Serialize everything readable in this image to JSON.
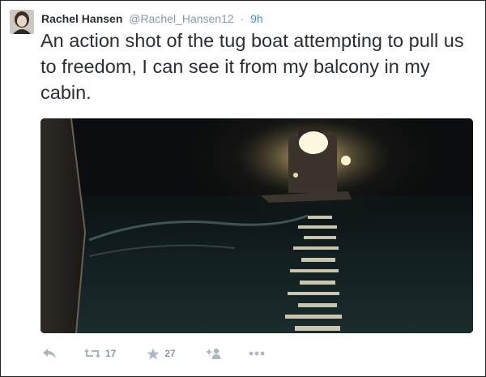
{
  "tweet": {
    "author_name": "Rachel Hansen",
    "author_handle": "@Rachel_Hansen12",
    "separator": "·",
    "timestamp": "9h",
    "text": "An action shot of the tug boat attempting to pull us to freedom, I can see it from my balcony in my cabin."
  },
  "actions": {
    "reply_icon": "reply-icon",
    "retweet_icon": "retweet-icon",
    "retweet_count": "17",
    "favorite_icon": "star-icon",
    "favorite_count": "27",
    "follow_icon": "follow-icon",
    "more_icon": "more-icon"
  },
  "colors": {
    "link": "#3b94d9",
    "muted": "#8899a6",
    "text": "#292f33"
  }
}
